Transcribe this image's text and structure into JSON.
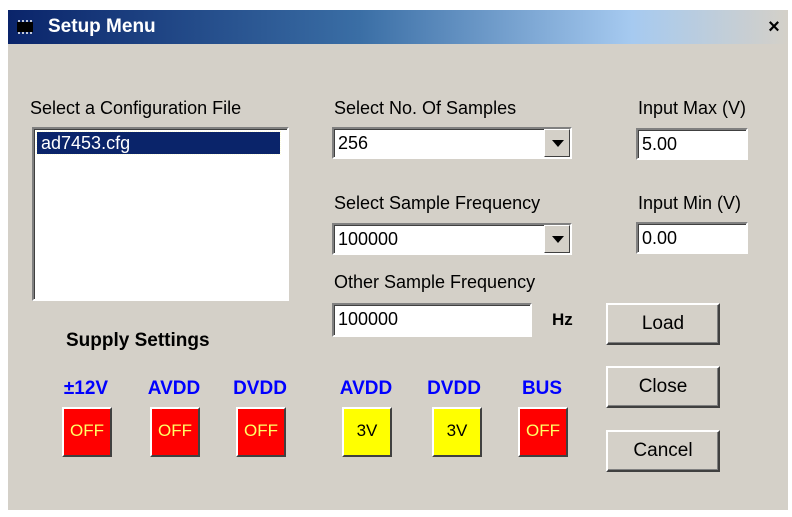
{
  "window": {
    "title": "Setup Menu",
    "close_glyph": "×"
  },
  "config": {
    "label": "Select a Configuration File",
    "files": [
      "ad7453.cfg"
    ],
    "selected_index": 0
  },
  "samples": {
    "label": "Select No. Of Samples",
    "value": "256"
  },
  "frequency": {
    "label": "Select Sample Frequency",
    "value": "100000"
  },
  "other_frequency": {
    "label": "Other Sample Frequency",
    "value": "100000",
    "unit": "Hz"
  },
  "input_max": {
    "label": "Input Max (V)",
    "value": "5.00"
  },
  "input_min": {
    "label": "Input Min (V)",
    "value": "0.00"
  },
  "buttons": {
    "load": "Load",
    "close": "Close",
    "cancel": "Cancel"
  },
  "supply": {
    "title": "Supply Settings",
    "rails": [
      {
        "label": "±12V",
        "state": "OFF"
      },
      {
        "label": "AVDD",
        "state": "OFF"
      },
      {
        "label": "DVDD",
        "state": "OFF"
      },
      {
        "label": "AVDD",
        "state": "3V"
      },
      {
        "label": "DVDD",
        "state": "3V"
      },
      {
        "label": "BUS",
        "state": "OFF"
      }
    ]
  },
  "colors": {
    "off": "#ff0000",
    "on": "#ffff00",
    "rail_label": "#0000ff",
    "titlebar": "#0a246a"
  },
  "icons": {
    "title": "chip-icon",
    "close": "close-icon",
    "dropdown": "chevron-down-icon"
  }
}
